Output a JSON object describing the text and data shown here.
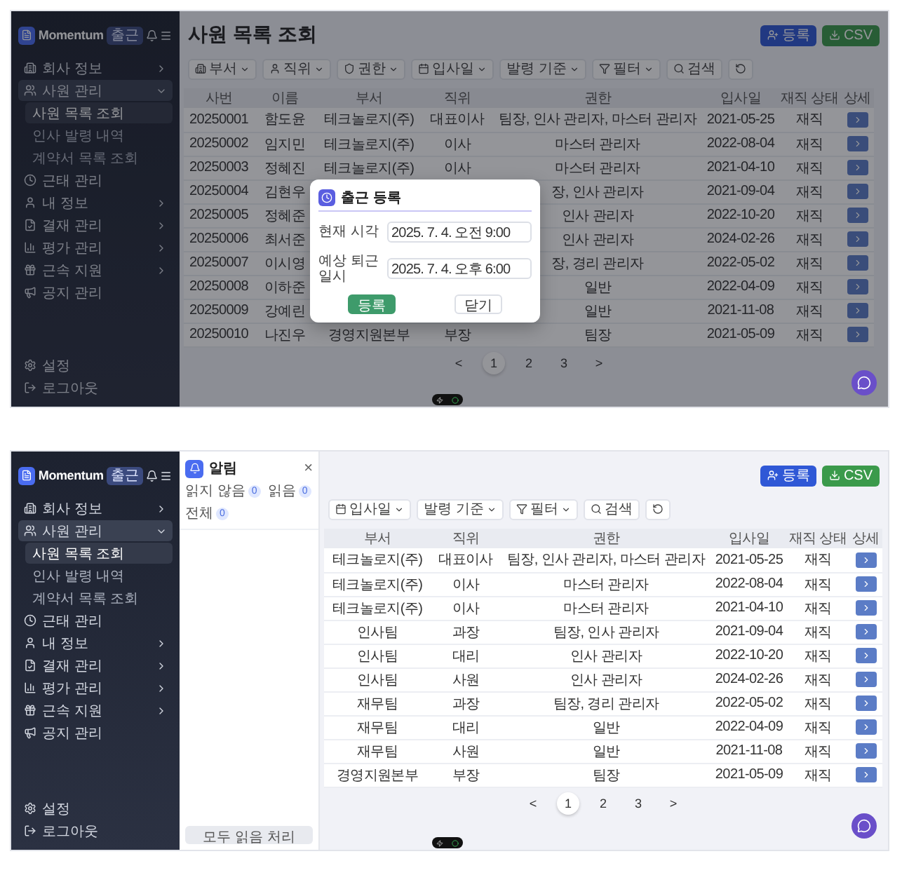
{
  "screens": [
    {
      "sidebar": {
        "brand": "Momentum",
        "badge": "출근",
        "items": [
          {
            "label": "회사 정보",
            "expanded": false
          },
          {
            "label": "사원 관리",
            "expanded": true,
            "children": [
              {
                "label": "사원 목록 조회",
                "selected": true
              },
              {
                "label": "인사 발령 내역",
                "selected": false
              },
              {
                "label": "계약서 목록 조회",
                "selected": false
              }
            ]
          },
          {
            "label": "근태 관리"
          },
          {
            "label": "내 정보",
            "expanded": false
          },
          {
            "label": "결재 관리",
            "expanded": false
          },
          {
            "label": "평가 관리",
            "expanded": false
          },
          {
            "label": "근속 지원",
            "expanded": false
          },
          {
            "label": "공지 관리"
          }
        ],
        "footer": [
          {
            "label": "설정"
          },
          {
            "label": "로그아웃"
          }
        ]
      },
      "page": {
        "title": "사원 목록 조회",
        "actions": [
          {
            "label": "등록",
            "kind": "primary"
          },
          {
            "label": "CSV",
            "kind": "export"
          }
        ],
        "filters": [
          {
            "label": "부서",
            "kind": "department"
          },
          {
            "label": "직위",
            "kind": "position"
          },
          {
            "label": "권한",
            "kind": "role"
          },
          {
            "label": "입사일",
            "kind": "hire_date"
          },
          {
            "label": "발령 기준",
            "kind": "appointment"
          },
          {
            "label": "필터",
            "kind": "filter"
          },
          {
            "label": "검색",
            "kind": "search"
          },
          {
            "kind": "reset"
          }
        ],
        "columns": [
          {
            "label": "사번",
            "kind": "id"
          },
          {
            "label": "이름",
            "kind": "name"
          },
          {
            "label": "부서",
            "kind": "department"
          },
          {
            "label": "직위",
            "kind": "position"
          },
          {
            "label": "권한",
            "kind": "role"
          },
          {
            "label": "입사일",
            "kind": "hire_date"
          },
          {
            "label": "재직 상태",
            "kind": "status"
          },
          {
            "label": "상세",
            "kind": "detail"
          }
        ],
        "rows": [
          {
            "id": "20250001",
            "name": "함도윤",
            "department": "테크놀로지(주)",
            "position": "대표이사",
            "role": "팀장, 인사 관리자, 마스터 관리자",
            "hire_date": "2021-05-25",
            "status": "재직"
          },
          {
            "id": "20250002",
            "name": "임지민",
            "department": "테크놀로지(주)",
            "position": "이사",
            "role": "마스터 관리자",
            "hire_date": "2022-08-04",
            "status": "재직"
          },
          {
            "id": "20250003",
            "name": "정혜진",
            "department": "테크놀로지(주)",
            "position": "이사",
            "role": "마스터 관리자",
            "hire_date": "2021-04-10",
            "status": "재직"
          },
          {
            "id": "20250004",
            "name": "김현우",
            "role": "장, 인사 관리자",
            "hire_date": "2021-09-04",
            "status": "재직"
          },
          {
            "id": "20250005",
            "name": "정혜준",
            "role": "인사 관리자",
            "hire_date": "2022-10-20",
            "status": "재직"
          },
          {
            "id": "20250006",
            "name": "최서준",
            "role": "인사 관리자",
            "hire_date": "2024-02-26",
            "status": "재직"
          },
          {
            "id": "20250007",
            "name": "이시영",
            "role": "장, 경리 관리자",
            "hire_date": "2022-05-02",
            "status": "재직"
          },
          {
            "id": "20250008",
            "name": "이하준",
            "role": "일반",
            "hire_date": "2022-04-09",
            "status": "재직"
          },
          {
            "id": "20250009",
            "name": "강예린",
            "role": "일반",
            "hire_date": "2021-11-08",
            "status": "재직"
          },
          {
            "id": "20250010",
            "name": "나진우",
            "department": "경영지원본부",
            "position": "부장",
            "role": "팀장",
            "hire_date": "2021-05-09",
            "status": "재직"
          }
        ],
        "pagination": {
          "prev": "<",
          "pages": [
            {
              "label": "1",
              "selected": true
            },
            {
              "label": "2",
              "selected": false
            },
            {
              "label": "3",
              "selected": false
            }
          ],
          "next": ">"
        }
      },
      "modal": {
        "title": "출근 등록",
        "fields": [
          {
            "label": "현재 시각",
            "value": "2025. 7. 4. 오전 9:00"
          },
          {
            "label": "예상 퇴근 일시",
            "value": "2025. 7. 4. 오후 6:00"
          }
        ],
        "buttons": [
          {
            "label": "등록",
            "kind": "primary"
          },
          {
            "label": "닫기",
            "kind": "secondary"
          }
        ]
      }
    },
    {
      "sidebar": {
        "brand": "Momentum",
        "badge": "출근",
        "items": [
          {
            "label": "회사 정보",
            "expanded": false
          },
          {
            "label": "사원 관리",
            "expanded": true,
            "children": [
              {
                "label": "사원 목록 조회",
                "selected": true
              },
              {
                "label": "인사 발령 내역",
                "selected": false
              },
              {
                "label": "계약서 목록 조회",
                "selected": false
              }
            ]
          },
          {
            "label": "근태 관리"
          },
          {
            "label": "내 정보",
            "expanded": false
          },
          {
            "label": "결재 관리",
            "expanded": false
          },
          {
            "label": "평가 관리",
            "expanded": false
          },
          {
            "label": "근속 지원",
            "expanded": false
          },
          {
            "label": "공지 관리"
          }
        ],
        "footer": [
          {
            "label": "설정"
          },
          {
            "label": "로그아웃"
          }
        ]
      },
      "notifications": {
        "title": "알림",
        "close": "×",
        "tabs": [
          {
            "label": "읽지 않음",
            "count": "0"
          },
          {
            "label": "읽음",
            "count": "0"
          },
          {
            "label": "전체",
            "count": "0"
          }
        ],
        "footer_button": "모두 읽음 처리"
      },
      "page": {
        "actions": [
          {
            "label": "등록",
            "kind": "primary"
          },
          {
            "label": "CSV",
            "kind": "export"
          }
        ],
        "filters": [
          {
            "label": "입사일",
            "kind": "hire_date"
          },
          {
            "label": "발령 기준",
            "kind": "appointment"
          },
          {
            "label": "필터",
            "kind": "filter"
          },
          {
            "label": "검색",
            "kind": "search"
          },
          {
            "kind": "reset"
          }
        ],
        "columns": [
          {
            "label": "부서",
            "kind": "department"
          },
          {
            "label": "직위",
            "kind": "position"
          },
          {
            "label": "권한",
            "kind": "role"
          },
          {
            "label": "입사일",
            "kind": "hire_date"
          },
          {
            "label": "재직 상태",
            "kind": "status"
          },
          {
            "label": "상세",
            "kind": "detail"
          }
        ],
        "rows": [
          {
            "department": "테크놀로지(주)",
            "position": "대표이사",
            "role": "팀장, 인사 관리자, 마스터 관리자",
            "hire_date": "2021-05-25",
            "status": "재직"
          },
          {
            "department": "테크놀로지(주)",
            "position": "이사",
            "role": "마스터 관리자",
            "hire_date": "2022-08-04",
            "status": "재직"
          },
          {
            "department": "테크놀로지(주)",
            "position": "이사",
            "role": "마스터 관리자",
            "hire_date": "2021-04-10",
            "status": "재직"
          },
          {
            "department": "인사팀",
            "position": "과장",
            "role": "팀장, 인사 관리자",
            "hire_date": "2021-09-04",
            "status": "재직"
          },
          {
            "department": "인사팀",
            "position": "대리",
            "role": "인사 관리자",
            "hire_date": "2022-10-20",
            "status": "재직"
          },
          {
            "department": "인사팀",
            "position": "사원",
            "role": "인사 관리자",
            "hire_date": "2024-02-26",
            "status": "재직"
          },
          {
            "department": "재무팀",
            "position": "과장",
            "role": "팀장, 경리 관리자",
            "hire_date": "2022-05-02",
            "status": "재직"
          },
          {
            "department": "재무팀",
            "position": "대리",
            "role": "일반",
            "hire_date": "2022-04-09",
            "status": "재직"
          },
          {
            "department": "재무팀",
            "position": "사원",
            "role": "일반",
            "hire_date": "2021-11-08",
            "status": "재직"
          },
          {
            "department": "경영지원본부",
            "position": "부장",
            "role": "팀장",
            "hire_date": "2021-05-09",
            "status": "재직"
          }
        ],
        "pagination": {
          "prev": "<",
          "pages": [
            {
              "label": "1",
              "selected": true
            },
            {
              "label": "2",
              "selected": false
            },
            {
              "label": "3",
              "selected": false
            }
          ],
          "next": ">"
        }
      }
    }
  ]
}
